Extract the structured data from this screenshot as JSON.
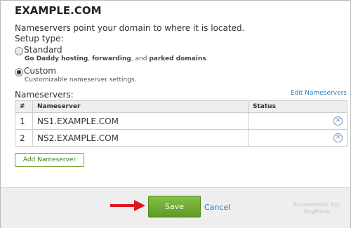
{
  "page": {
    "title": "EXAMPLE.COM",
    "description": "Nameservers point your domain to where it is located.",
    "setup_type_label": "Setup type:"
  },
  "options": [
    {
      "label": "Standard",
      "checked": false,
      "sub_parts": [
        "Go Daddy hosting",
        ", ",
        "forwarding",
        ", and ",
        "parked domains",
        "."
      ]
    },
    {
      "label": "Custom",
      "checked": true,
      "sub": "Customizable nameserver settings."
    }
  ],
  "nameservers": {
    "label": "Nameservers:",
    "edit_link": "Edit Nameservers",
    "columns": [
      "#",
      "Nameserver",
      "Status"
    ],
    "rows": [
      {
        "num": "1",
        "name": "NS1.EXAMPLE.COM",
        "status": ""
      },
      {
        "num": "2",
        "name": "NS2.EXAMPLE.COM",
        "status": ""
      }
    ],
    "add_button": "Add Nameserver"
  },
  "footer": {
    "save": "Save",
    "cancel": "Cancel",
    "watermark_line1": "Screenshot by:",
    "watermark_line2": "OrgPack"
  },
  "colors": {
    "accent_green": "#6aa92f",
    "link_blue": "#2a7ab8",
    "arrow_red": "#e0141c"
  }
}
